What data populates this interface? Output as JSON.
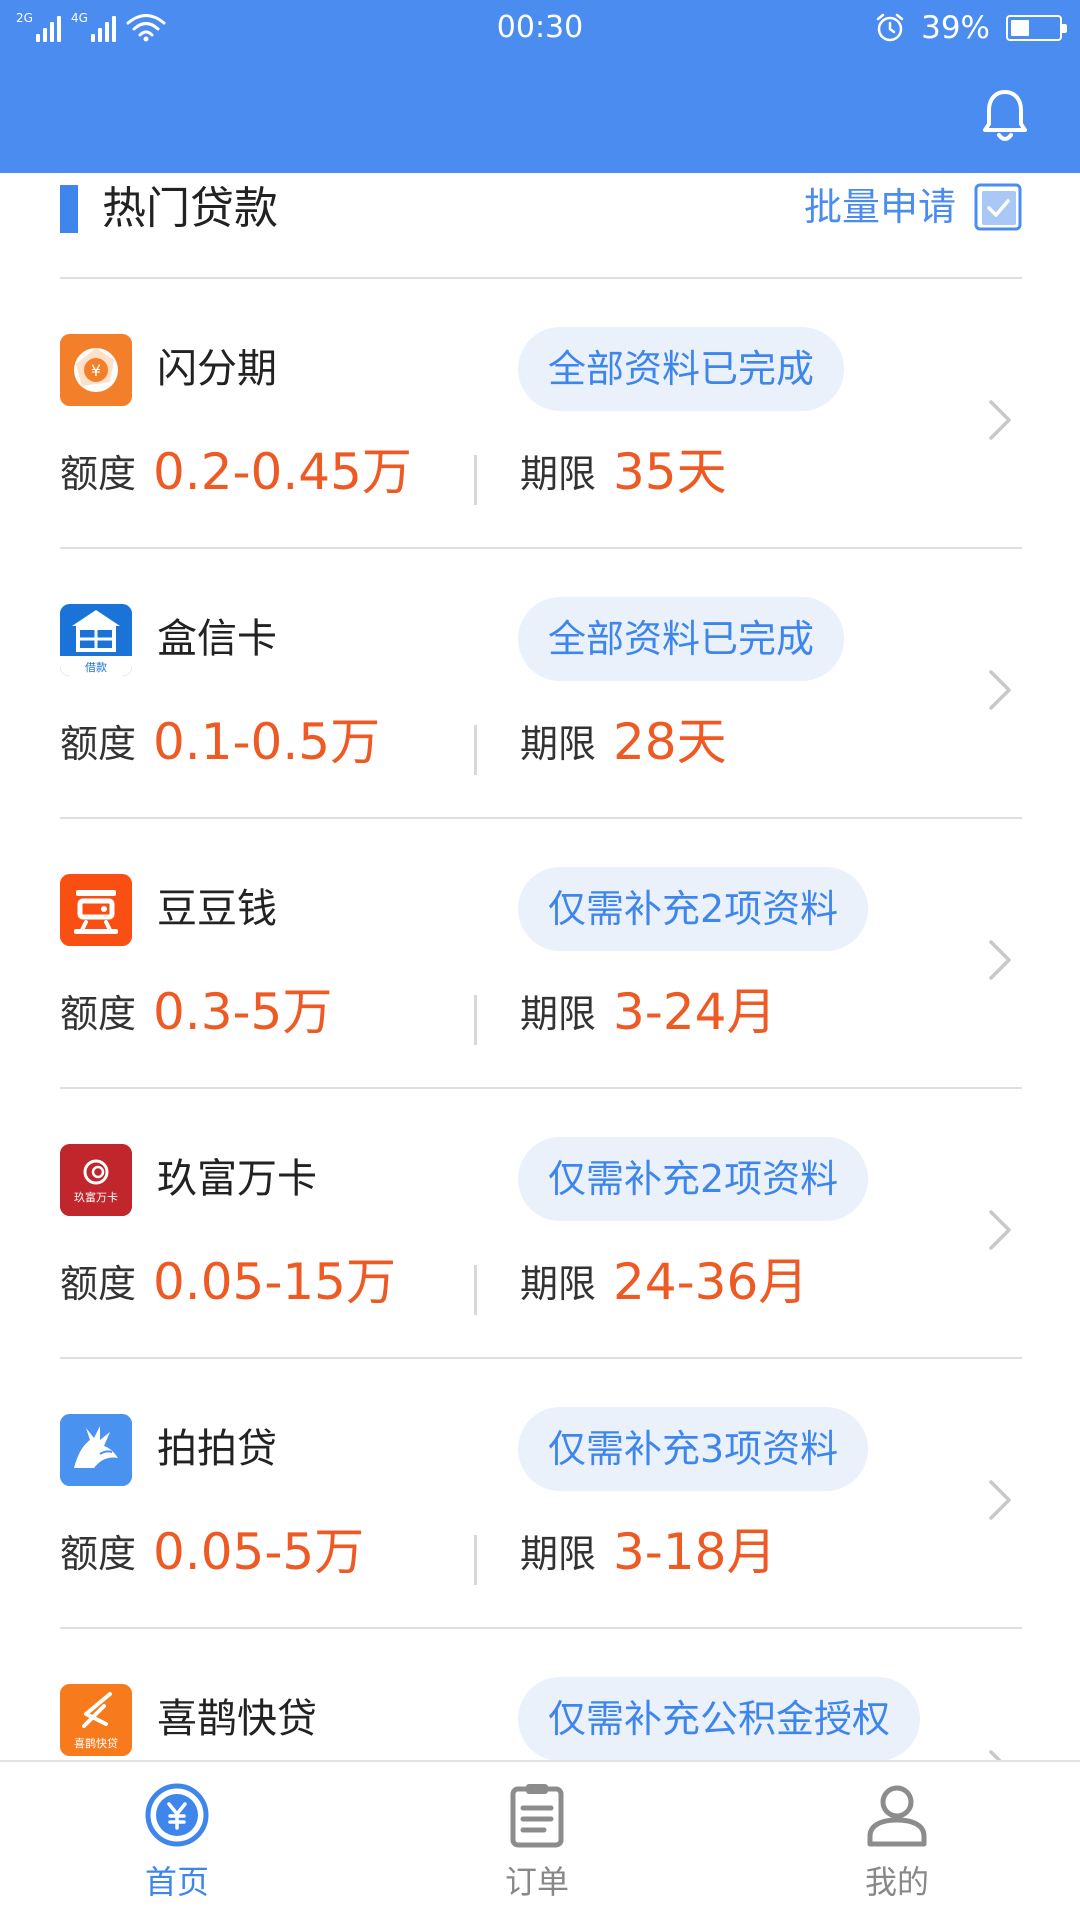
{
  "status_bar": {
    "network_1": "2G",
    "network_2": "4G",
    "time": "00:30",
    "battery_text": "39%",
    "battery_level": 0.39
  },
  "section": {
    "title": "热门贷款",
    "batch_label": "批量申请"
  },
  "loans": [
    {
      "name": "闪分期",
      "status": "全部资料已完成",
      "amount_label": "额度",
      "amount": "0.2-0.45万",
      "term_label": "期限",
      "term": "35天"
    },
    {
      "name": "盒信卡",
      "status": "全部资料已完成",
      "amount_label": "额度",
      "amount": "0.1-0.5万",
      "term_label": "期限",
      "term": "28天"
    },
    {
      "name": "豆豆钱",
      "status": "仅需补充2项资料",
      "amount_label": "额度",
      "amount": "0.3-5万",
      "term_label": "期限",
      "term": "3-24月"
    },
    {
      "name": "玖富万卡",
      "status": "仅需补充2项资料",
      "amount_label": "额度",
      "amount": "0.05-15万",
      "term_label": "期限",
      "term": "24-36月"
    },
    {
      "name": "拍拍贷",
      "status": "仅需补充3项资料",
      "amount_label": "额度",
      "amount": "0.05-5万",
      "term_label": "期限",
      "term": "3-18月"
    },
    {
      "name": "喜鹊快贷",
      "status": "仅需补充公积金授权",
      "amount_label": "",
      "amount": "",
      "term_label": "",
      "term": ""
    }
  ],
  "logos": {
    "hexinka_sub": "借款",
    "jiufu_text": "玖富万卡",
    "xique_text": "喜鹊快贷"
  },
  "tabs": [
    {
      "label": "首页",
      "icon": "yuan-coin-icon",
      "active": true
    },
    {
      "label": "订单",
      "icon": "clipboard-icon",
      "active": false
    },
    {
      "label": "我的",
      "icon": "person-icon",
      "active": false
    }
  ],
  "colors": {
    "primary_blue": "#4a8cf0",
    "accent_orange": "#ee5a24",
    "pill_bg": "#eaf1fb"
  }
}
